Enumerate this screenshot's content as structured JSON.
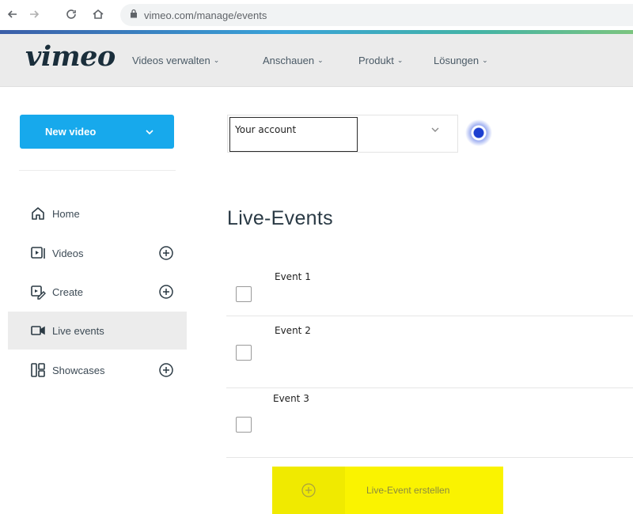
{
  "browser": {
    "url": "vimeo.com/manage/events"
  },
  "topnav": {
    "logo": "vimeo",
    "items": [
      {
        "label": "Videos verwalten"
      },
      {
        "label": "Anschauen"
      },
      {
        "label": "Produkt"
      },
      {
        "label": "Lösungen"
      }
    ]
  },
  "sidebar": {
    "new_video_label": "New video",
    "items": [
      {
        "label": "Home",
        "icon": "home-icon"
      },
      {
        "label": "Videos",
        "icon": "video-icon",
        "has_add": true
      },
      {
        "label": "Create",
        "icon": "create-icon",
        "has_add": true
      },
      {
        "label": "Live events",
        "icon": "camera-icon",
        "active": true
      },
      {
        "label": "Showcases",
        "icon": "showcase-icon",
        "has_add": true
      }
    ]
  },
  "account_select": {
    "value": "Your account"
  },
  "main": {
    "title": "Live-Events",
    "events": [
      {
        "name": "Event 1",
        "checked": false
      },
      {
        "name": "Event 2",
        "checked": false
      },
      {
        "name": "Event 3",
        "checked": false
      }
    ],
    "create_label": "Live-Event erstellen"
  },
  "colors": {
    "brand_blue": "#17a9ec",
    "highlight_yellow": "#faf300",
    "radio_blue": "#1d3fd0"
  }
}
